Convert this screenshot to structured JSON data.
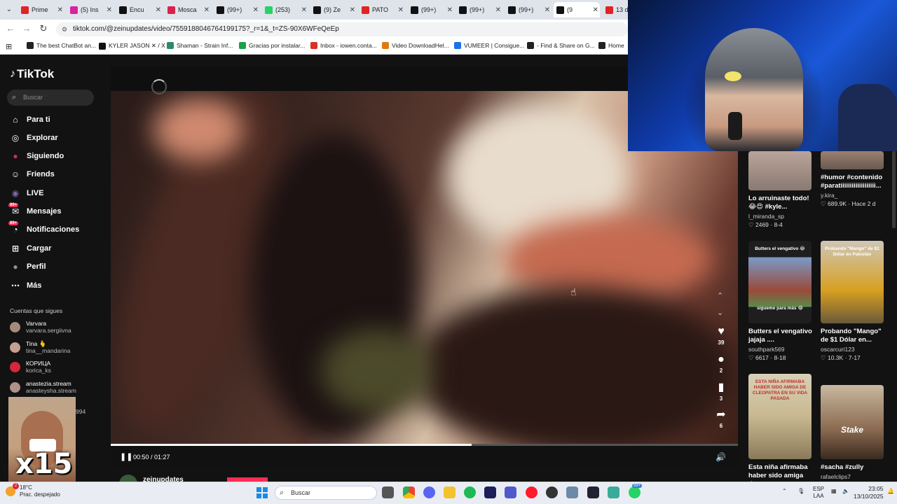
{
  "browser": {
    "tabs": [
      {
        "label": "Prime",
        "color": "#e02424"
      },
      {
        "label": "(5) Ins",
        "color": "#d6249f"
      },
      {
        "label": "Encu",
        "color": "#111111"
      },
      {
        "label": "Mosca",
        "color": "#d9234a"
      },
      {
        "label": "(99+)",
        "color": "#111111"
      },
      {
        "label": "(253)",
        "color": "#25d366"
      },
      {
        "label": "(9) Ze",
        "color": "#111111"
      },
      {
        "label": "PATO",
        "color": "#e02424"
      },
      {
        "label": "(99+)",
        "color": "#111111"
      },
      {
        "label": "(99+)",
        "color": "#111111"
      },
      {
        "label": "(99+)",
        "color": "#111111"
      },
      {
        "label": "(9",
        "color": "#111111"
      },
      {
        "label": "13 d",
        "color": "#e02424"
      }
    ],
    "url": "tiktok.com/@zeinupdates/video/7559188046764199175?_r=1&_t=ZS-90X6WFeQeEp",
    "bookmarks": [
      {
        "label": "The best ChatBot an...",
        "color": "#222"
      },
      {
        "label": "KYLER JASON ✕ / X",
        "color": "#111"
      },
      {
        "label": "Shaman - Strain Inf...",
        "color": "#2a8a6a"
      },
      {
        "label": "Gracias por instalar...",
        "color": "#1aa14a"
      },
      {
        "label": "Inbox - iowen.conta...",
        "color": "#d93025"
      },
      {
        "label": "Video DownloadHel...",
        "color": "#e07a10"
      },
      {
        "label": "VUMEER | Consigue...",
        "color": "#1a73e8"
      },
      {
        "label": "- Find & Share on G...",
        "color": "#222"
      },
      {
        "label": "Home",
        "color": "#222"
      }
    ]
  },
  "tiktok": {
    "logo": "TikTok",
    "search_placeholder": "Buscar",
    "nav": [
      {
        "label": "Para ti",
        "icon": "home-icon"
      },
      {
        "label": "Explorar",
        "icon": "compass-icon"
      },
      {
        "label": "Siguiendo",
        "icon": "following-icon"
      },
      {
        "label": "Friends",
        "icon": "friends-icon"
      },
      {
        "label": "LIVE",
        "icon": "live-icon"
      },
      {
        "label": "Mensajes",
        "icon": "messages-icon",
        "badge": "99+"
      },
      {
        "label": "Notificaciones",
        "icon": "bell-icon",
        "badge": "99+"
      },
      {
        "label": "Cargar",
        "icon": "upload-icon"
      },
      {
        "label": "Perfil",
        "icon": "profile-icon"
      },
      {
        "label": "Más",
        "icon": "more-icon"
      }
    ],
    "following_title": "Cuentas que sigues",
    "following": [
      {
        "name": "Varvara",
        "handle": "varvara.sergiivna",
        "color": "#a58a7a"
      },
      {
        "name": "Tina 🫰",
        "handle": "tina__mandarina",
        "color": "#c4a090"
      },
      {
        "name": "КОРИЦА",
        "handle": "korica_ks",
        "color": "#d4283a"
      },
      {
        "name": "anastezia.stream",
        "handle": "anasteysha.stream",
        "color": "#b0908a"
      }
    ],
    "following_partial": "994",
    "video": {
      "elapsed": "00:50",
      "duration": "01:27",
      "time_text": "00:50 / 01:27",
      "progress": 0.575,
      "author": "zeinupdates"
    },
    "actions": [
      {
        "icon": "heart-icon",
        "count": "39"
      },
      {
        "icon": "comment-icon",
        "count": "2"
      },
      {
        "icon": "bookmark-icon",
        "count": "3"
      },
      {
        "icon": "share-icon",
        "count": "6"
      }
    ],
    "recommended": [
      {
        "title": "Lo arruinaste todo! 😂😍 #kyle...",
        "user": "l_miranda_sp",
        "likes": "2469",
        "date": "8-4",
        "overlay": ""
      },
      {
        "title": "#humor #contenido #paratiiiiiiiiiiiiiiiiiii...",
        "user": "y.kira_",
        "likes": "689.9K",
        "date": "Hace 2 d",
        "overlay": ""
      },
      {
        "title": "Butters el vengativo jajaja ....",
        "user": "southpark569",
        "likes": "6617",
        "date": "8-18",
        "overlay": "Butters el vengativo 😂",
        "overlay2": "sígueme para más 😂"
      },
      {
        "title": "Probando \"Mango\" de $1 Dólar en...",
        "user": "oscarcuri123",
        "likes": "10.3K",
        "date": "7-17",
        "overlay": "Probando \"Mango\" de $1 Dólar en Pakistán"
      },
      {
        "title": "Esta niña afirmaba haber sido amiga d...",
        "user": "",
        "likes": "",
        "date": "",
        "overlay": "ESTA NIÑA AFIRMABA HABER SIDO AMIGA DE CLEOPATRA EN SU VIDA PASADA"
      },
      {
        "title": "#sacha #zully",
        "user": "rafaelclips7",
        "likes": "",
        "date": "",
        "overlay": "Stake"
      }
    ]
  },
  "overlays": {
    "multiplier": "x15"
  },
  "taskbar": {
    "temp": "18°C",
    "weather": "Prac. despejado",
    "weather_badge": "2",
    "search_placeholder": "Buscar",
    "lang": "ESP",
    "lang2": "LAA",
    "time": "23:05",
    "date": "13/10/2025",
    "notif_badge": "99+"
  }
}
